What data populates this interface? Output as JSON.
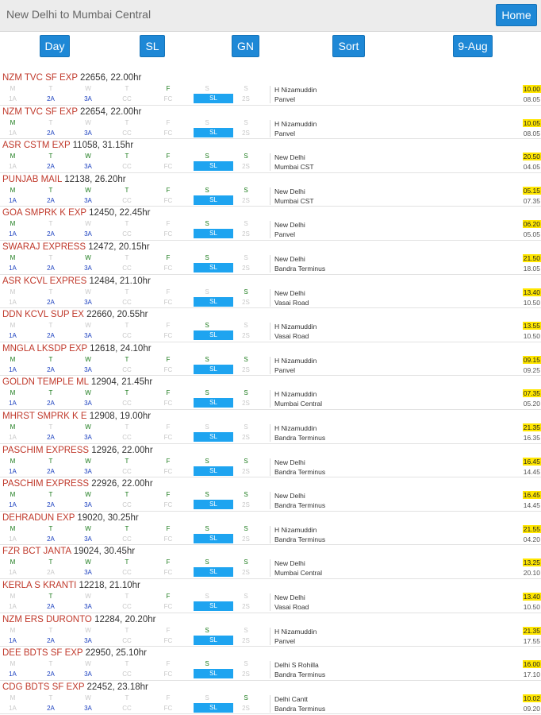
{
  "header": {
    "title": "New Delhi to Mumbai Central",
    "home_label": "Home"
  },
  "toolbar": [
    {
      "label": "Day",
      "name": "day-button"
    },
    {
      "label": "SL",
      "name": "sl-button"
    },
    {
      "label": "GN",
      "name": "gn-button"
    },
    {
      "label": "Sort",
      "name": "sort-button"
    },
    {
      "label": "9-Aug",
      "name": "date-button"
    }
  ],
  "day_letters": [
    "M",
    "T",
    "W",
    "T",
    "F",
    "S",
    "S"
  ],
  "class_labels": [
    "1A",
    "2A",
    "3A",
    "CC",
    "FC",
    "SL",
    "2S"
  ],
  "colors": {
    "accent": "#1e88d6",
    "train_name": "#c0392b",
    "day_on": "#1a7a1a",
    "class_on": "#1a3fbf",
    "sl_highlight": "#1ea4f0",
    "time_highlight": "#ffe600"
  },
  "trains": [
    {
      "name": "NZM TVC SF EXP",
      "info": "22656, 22.00hr",
      "days": [
        0,
        0,
        0,
        0,
        1,
        0,
        0
      ],
      "classes": [
        0,
        1,
        1,
        0,
        0,
        1,
        0
      ],
      "from": "H Nizamuddin",
      "to": "Panvel",
      "dep": "10.00",
      "arr": "08.05"
    },
    {
      "name": "NZM TVC SF EXP",
      "info": "22654, 22.00hr",
      "days": [
        1,
        0,
        0,
        0,
        0,
        0,
        0
      ],
      "classes": [
        0,
        1,
        1,
        0,
        0,
        1,
        0
      ],
      "from": "H Nizamuddin",
      "to": "Panvel",
      "dep": "10.05",
      "arr": "08.05"
    },
    {
      "name": "ASR CSTM EXP",
      "info": "11058, 31.15hr",
      "days": [
        1,
        1,
        1,
        1,
        1,
        1,
        1
      ],
      "classes": [
        0,
        1,
        1,
        0,
        0,
        1,
        0
      ],
      "from": "New Delhi",
      "to": "Mumbai CST",
      "dep": "20.50",
      "arr": "04.05"
    },
    {
      "name": "PUNJAB MAIL",
      "info": "12138, 26.20hr",
      "days": [
        1,
        1,
        1,
        1,
        1,
        1,
        1
      ],
      "classes": [
        1,
        1,
        1,
        0,
        0,
        1,
        0
      ],
      "from": "New Delhi",
      "to": "Mumbai CST",
      "dep": "05.15",
      "arr": "07.35"
    },
    {
      "name": "GOA SMPRK K EXP",
      "info": "12450, 22.45hr",
      "days": [
        1,
        0,
        0,
        0,
        0,
        1,
        0
      ],
      "classes": [
        1,
        1,
        1,
        0,
        0,
        1,
        0
      ],
      "from": "New Delhi",
      "to": "Panvel",
      "dep": "06.20",
      "arr": "05.05"
    },
    {
      "name": "SWARAJ EXPRESS",
      "info": "12472, 20.15hr",
      "days": [
        1,
        0,
        1,
        0,
        1,
        1,
        0
      ],
      "classes": [
        1,
        1,
        1,
        0,
        0,
        1,
        0
      ],
      "from": "New Delhi",
      "to": "Bandra Terminus",
      "dep": "21.50",
      "arr": "18.05"
    },
    {
      "name": "ASR KCVL EXPRES",
      "info": "12484, 21.10hr",
      "days": [
        0,
        0,
        0,
        0,
        0,
        0,
        1
      ],
      "classes": [
        0,
        1,
        1,
        0,
        0,
        1,
        0
      ],
      "from": "New Delhi",
      "to": "Vasai Road",
      "dep": "13.40",
      "arr": "10.50"
    },
    {
      "name": "DDN KCVL SUP EX",
      "info": "22660, 20.55hr",
      "days": [
        0,
        0,
        0,
        0,
        0,
        1,
        0
      ],
      "classes": [
        1,
        1,
        1,
        0,
        0,
        1,
        0
      ],
      "from": "H Nizamuddin",
      "to": "Vasai Road",
      "dep": "13.55",
      "arr": "10.50"
    },
    {
      "name": "MNGLA LKSDP EXP",
      "info": "12618, 24.10hr",
      "days": [
        1,
        1,
        1,
        1,
        1,
        1,
        1
      ],
      "classes": [
        1,
        1,
        1,
        0,
        0,
        1,
        0
      ],
      "from": "H Nizamuddin",
      "to": "Panvel",
      "dep": "09.15",
      "arr": "09.25"
    },
    {
      "name": "GOLDN TEMPLE ML",
      "info": "12904, 21.45hr",
      "days": [
        1,
        1,
        1,
        1,
        1,
        1,
        1
      ],
      "classes": [
        1,
        1,
        1,
        0,
        0,
        1,
        0
      ],
      "from": "H Nizamuddin",
      "to": "Mumbai Central",
      "dep": "07.35",
      "arr": "05.20"
    },
    {
      "name": "MHRST SMPRK K E",
      "info": "12908, 19.00hr",
      "days": [
        1,
        0,
        1,
        0,
        0,
        0,
        0
      ],
      "classes": [
        0,
        1,
        1,
        0,
        0,
        1,
        0
      ],
      "from": "H Nizamuddin",
      "to": "Bandra Terminus",
      "dep": "21.35",
      "arr": "16.35"
    },
    {
      "name": "PASCHIM EXPRESS",
      "info": "12926, 22.00hr",
      "days": [
        1,
        1,
        1,
        1,
        1,
        1,
        1
      ],
      "classes": [
        1,
        1,
        1,
        0,
        0,
        1,
        0
      ],
      "from": "New Delhi",
      "to": "Bandra Terminus",
      "dep": "16.45",
      "arr": "14.45"
    },
    {
      "name": "PASCHIM EXPRESS",
      "info": "22926, 22.00hr",
      "days": [
        1,
        1,
        1,
        1,
        1,
        1,
        1
      ],
      "classes": [
        1,
        1,
        1,
        0,
        0,
        1,
        0
      ],
      "from": "New Delhi",
      "to": "Bandra Terminus",
      "dep": "16.45",
      "arr": "14.45"
    },
    {
      "name": "DEHRADUN EXP",
      "info": "19020, 30.25hr",
      "days": [
        1,
        1,
        1,
        1,
        1,
        1,
        1
      ],
      "classes": [
        0,
        1,
        1,
        0,
        0,
        1,
        0
      ],
      "from": "H Nizamuddin",
      "to": "Bandra Terminus",
      "dep": "21.55",
      "arr": "04.20"
    },
    {
      "name": "FZR BCT JANTA",
      "info": "19024, 30.45hr",
      "days": [
        1,
        1,
        1,
        1,
        1,
        1,
        1
      ],
      "classes": [
        0,
        0,
        1,
        0,
        0,
        1,
        0
      ],
      "from": "New Delhi",
      "to": "Mumbai Central",
      "dep": "13.25",
      "arr": "20.10"
    },
    {
      "name": "KERLA S KRANTI",
      "info": "12218, 21.10hr",
      "days": [
        0,
        1,
        0,
        0,
        1,
        0,
        0
      ],
      "classes": [
        0,
        1,
        1,
        0,
        0,
        1,
        0
      ],
      "from": "New Delhi",
      "to": "Vasai Road",
      "dep": "13.40",
      "arr": "10.50"
    },
    {
      "name": "NZM ERS DURONTO",
      "info": "12284, 20.20hr",
      "days": [
        0,
        0,
        0,
        0,
        0,
        1,
        0
      ],
      "classes": [
        1,
        1,
        1,
        0,
        0,
        1,
        0
      ],
      "from": "H Nizamuddin",
      "to": "Panvel",
      "dep": "21.35",
      "arr": "17.55"
    },
    {
      "name": "DEE BDTS SF EXP",
      "info": "22950, 25.10hr",
      "days": [
        0,
        0,
        0,
        0,
        0,
        1,
        0
      ],
      "classes": [
        1,
        1,
        1,
        0,
        0,
        1,
        0
      ],
      "from": "Delhi S Rohilla",
      "to": "Bandra Terminus",
      "dep": "16.00",
      "arr": "17.10"
    },
    {
      "name": "CDG BDTS SF EXP",
      "info": "22452, 23.18hr",
      "days": [
        0,
        0,
        0,
        0,
        0,
        0,
        1
      ],
      "classes": [
        0,
        1,
        1,
        0,
        0,
        1,
        0
      ],
      "from": "Delhi Cantt",
      "to": "Bandra Terminus",
      "dep": "10.02",
      "arr": "09.20"
    }
  ]
}
